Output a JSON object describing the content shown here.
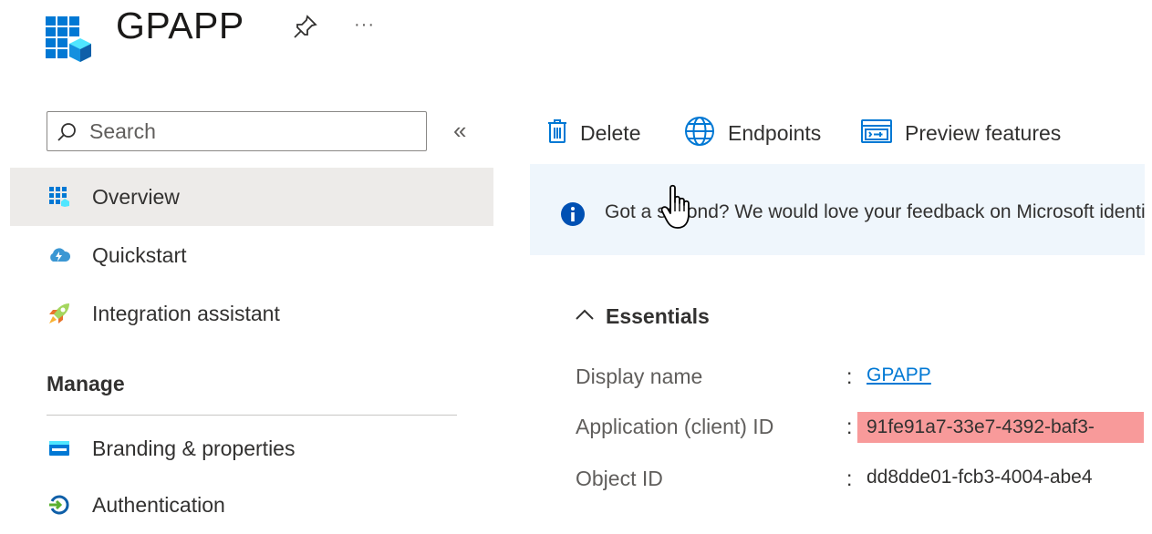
{
  "header": {
    "title": "GPAPP",
    "more_label": "···"
  },
  "sidebar": {
    "search_placeholder": "Search",
    "collapse_label": "«",
    "items": [
      {
        "label": "Overview",
        "icon": "overview-grid-icon",
        "selected": true
      },
      {
        "label": "Quickstart",
        "icon": "quickstart-cloud-icon",
        "selected": false
      },
      {
        "label": "Integration assistant",
        "icon": "rocket-icon",
        "selected": false
      }
    ],
    "manage_header": "Manage",
    "manage_items": [
      {
        "label": "Branding & properties",
        "icon": "branding-icon"
      },
      {
        "label": "Authentication",
        "icon": "authentication-icon"
      }
    ]
  },
  "toolbar": {
    "delete_label": "Delete",
    "endpoints_label": "Endpoints",
    "preview_label": "Preview features"
  },
  "banner": {
    "text": "Got a second? We would love your feedback on Microsoft identity platform"
  },
  "essentials": {
    "title": "Essentials",
    "display_name_label": "Display name",
    "display_name_value": "GPAPP",
    "client_id_label": "Application (client) ID",
    "client_id_value": "91fe91a7-33e7-4392-baf3-",
    "object_id_label": "Object ID",
    "object_id_value": "dd8dde01-fcb3-4004-abe4",
    "separator": ":"
  },
  "colors": {
    "accent": "#0078d4",
    "selected_bg": "#edebe9",
    "banner_bg": "#eff6fc",
    "highlight": "#f89a9a"
  }
}
